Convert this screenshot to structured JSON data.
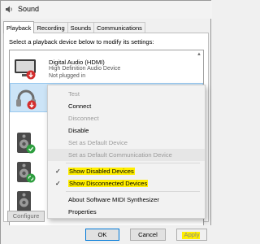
{
  "window": {
    "title": "Sound"
  },
  "tabs": [
    {
      "label": "Playback"
    },
    {
      "label": "Recording"
    },
    {
      "label": "Sounds"
    },
    {
      "label": "Communications"
    }
  ],
  "instruction": "Select a playback device below to modify its settings:",
  "devices": [
    {
      "name": "Digital Audio (HDMI)",
      "description": "High Definition Audio Device",
      "status": "Not plugged in",
      "icon": "monitor-icon"
    },
    {
      "name": "",
      "description": "",
      "status": "",
      "icon": "headphones-icon"
    },
    {
      "name": "",
      "description": "",
      "status": "",
      "icon": "speaker-icon"
    },
    {
      "name": "",
      "description": "",
      "status": "",
      "icon": "speaker-icon"
    }
  ],
  "context_menu": {
    "items": [
      {
        "label": "Test",
        "enabled": false
      },
      {
        "label": "Connect",
        "enabled": true
      },
      {
        "label": "Disconnect",
        "enabled": false
      },
      {
        "label": "Disable",
        "enabled": true
      },
      {
        "label": "Set as Default Device",
        "enabled": false
      },
      {
        "label": "Set as Default Communication Device",
        "enabled": false
      },
      {
        "label": "Show Disabled Devices",
        "enabled": true,
        "checked": true
      },
      {
        "label": "Show Disconnected Devices",
        "enabled": true,
        "checked": true
      },
      {
        "label": "About Software MIDI Synthesizer",
        "enabled": true
      },
      {
        "label": "Properties",
        "enabled": true
      }
    ]
  },
  "buttons": {
    "configure": "Configure",
    "ok": "OK",
    "cancel": "Cancel",
    "apply": "Apply"
  },
  "colors": {
    "selection": "#cce4f7",
    "highlight": "#ffee00",
    "status_red": "#d32f2f",
    "status_green": "#2e9e3f",
    "accent": "#0078d7"
  }
}
